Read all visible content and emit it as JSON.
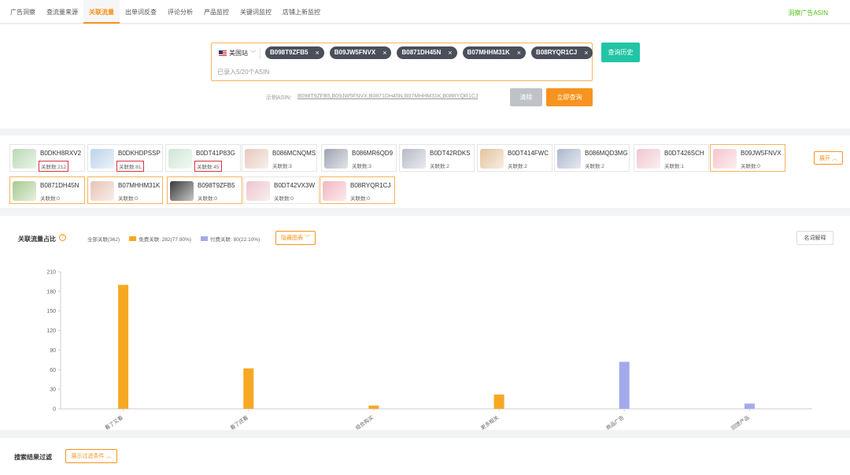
{
  "nav": {
    "tabs": [
      {
        "label": "广告洞察",
        "active": false
      },
      {
        "label": "查流量来源",
        "active": false
      },
      {
        "label": "关联流量",
        "active": true
      },
      {
        "label": "出单词反查",
        "active": false
      },
      {
        "label": "评论分析",
        "active": false
      },
      {
        "label": "产品监控",
        "active": false
      },
      {
        "label": "关键词监控",
        "active": false
      },
      {
        "label": "店铺上新监控",
        "active": false
      }
    ],
    "right_link": "洞察广告ASIN"
  },
  "search": {
    "site": "美国站",
    "asins": [
      "B098T9ZFB5",
      "B09JW5FNVX",
      "B0871DH45N",
      "B07MHHM31K",
      "B08RYQR1CJ"
    ],
    "entered_hint": "已录入5/20个ASIN",
    "history_button": "查询历史",
    "example_label": "示例ASIN:",
    "example_asins": "B098T9ZFB5,B09JW5FNVX,B0871DH45N,B07MHHM31K,B08RYQR1CJ",
    "clear_button": "清除",
    "query_button": "立即查询"
  },
  "products": {
    "expand_button": "展开 ︿",
    "items": [
      {
        "asin": "B0DKH8RXV2",
        "count": "关联数:212",
        "highlight": true,
        "selected": false,
        "color": "#b9d8b4"
      },
      {
        "asin": "B0DKHDPSSP",
        "count": "关联数:81",
        "highlight": true,
        "selected": false,
        "color": "#bcd3ea"
      },
      {
        "asin": "B0DT41P83G",
        "count": "关联数:45",
        "highlight": true,
        "selected": false,
        "color": "#cfe6d6"
      },
      {
        "asin": "B086MCNQMS",
        "count": "关联数:3",
        "highlight": false,
        "selected": false,
        "color": "#e6c9bd"
      },
      {
        "asin": "B086MR6QD9",
        "count": "关联数:3",
        "highlight": false,
        "selected": false,
        "color": "#9ea3b0"
      },
      {
        "asin": "B0DT42RDKS",
        "count": "关联数:2",
        "highlight": false,
        "selected": false,
        "color": "#b6bac6"
      },
      {
        "asin": "B0DT414FWC",
        "count": "关联数:2",
        "highlight": false,
        "selected": false,
        "color": "#e3c39e"
      },
      {
        "asin": "B086MQD3MG",
        "count": "关联数:2",
        "highlight": false,
        "selected": false,
        "color": "#aab7cc"
      },
      {
        "asin": "B0DT426SCH",
        "count": "关联数:1",
        "highlight": false,
        "selected": false,
        "color": "#f0c6cf"
      },
      {
        "asin": "B09JW5FNVX",
        "count": "关联数:0",
        "highlight": false,
        "selected": true,
        "color": "#f6c4cc"
      },
      {
        "asin": "B0871DH45N",
        "count": "关联数:0",
        "highlight": false,
        "selected": true,
        "color": "#a7c990"
      },
      {
        "asin": "B07MHHM31K",
        "count": "关联数:0",
        "highlight": false,
        "selected": true,
        "color": "#e8c3b6"
      },
      {
        "asin": "B098T9ZFB5",
        "count": "关联数:0",
        "highlight": false,
        "selected": true,
        "color": "#3a3a3a"
      },
      {
        "asin": "B0DT42VX3W",
        "count": "关联数:0",
        "highlight": false,
        "selected": false,
        "color": "#eec5cd"
      },
      {
        "asin": "B08RYQR1CJ",
        "count": "关联数:0",
        "highlight": false,
        "selected": true,
        "color": "#f1b6c0"
      }
    ]
  },
  "chart_section": {
    "title": "关联流量占比",
    "legend_all": "全部关联(362)",
    "legend_free": "免费关联: 282(77.90%)",
    "legend_paid": "付费关联: 80(22.10%)",
    "hide_chart_button": "隐藏图表 ﹀",
    "glossary_button": "名词解释"
  },
  "chart_data": {
    "type": "bar",
    "categories": [
      "看了又看",
      "看了还看",
      "组合购买",
      "更多相关",
      "商品广告",
      "回馈产品"
    ],
    "series": [
      {
        "name": "免费关联",
        "color": "#f7a823",
        "values": [
          190,
          62,
          5,
          22,
          0,
          0
        ]
      },
      {
        "name": "付费关联",
        "color": "#a3a9ec",
        "values": [
          0,
          0,
          0,
          0,
          72,
          8
        ]
      }
    ],
    "ylim": [
      0,
      210
    ],
    "yticks": [
      0,
      30,
      60,
      90,
      120,
      150,
      180,
      210
    ],
    "grid": false
  },
  "filter": {
    "title": "搜索结果过滤",
    "toggle_button": "展示过滤条件 ︿"
  },
  "colors": {
    "accent": "#f7931e",
    "teal": "#21c5a5",
    "link_green": "#52c41a"
  }
}
